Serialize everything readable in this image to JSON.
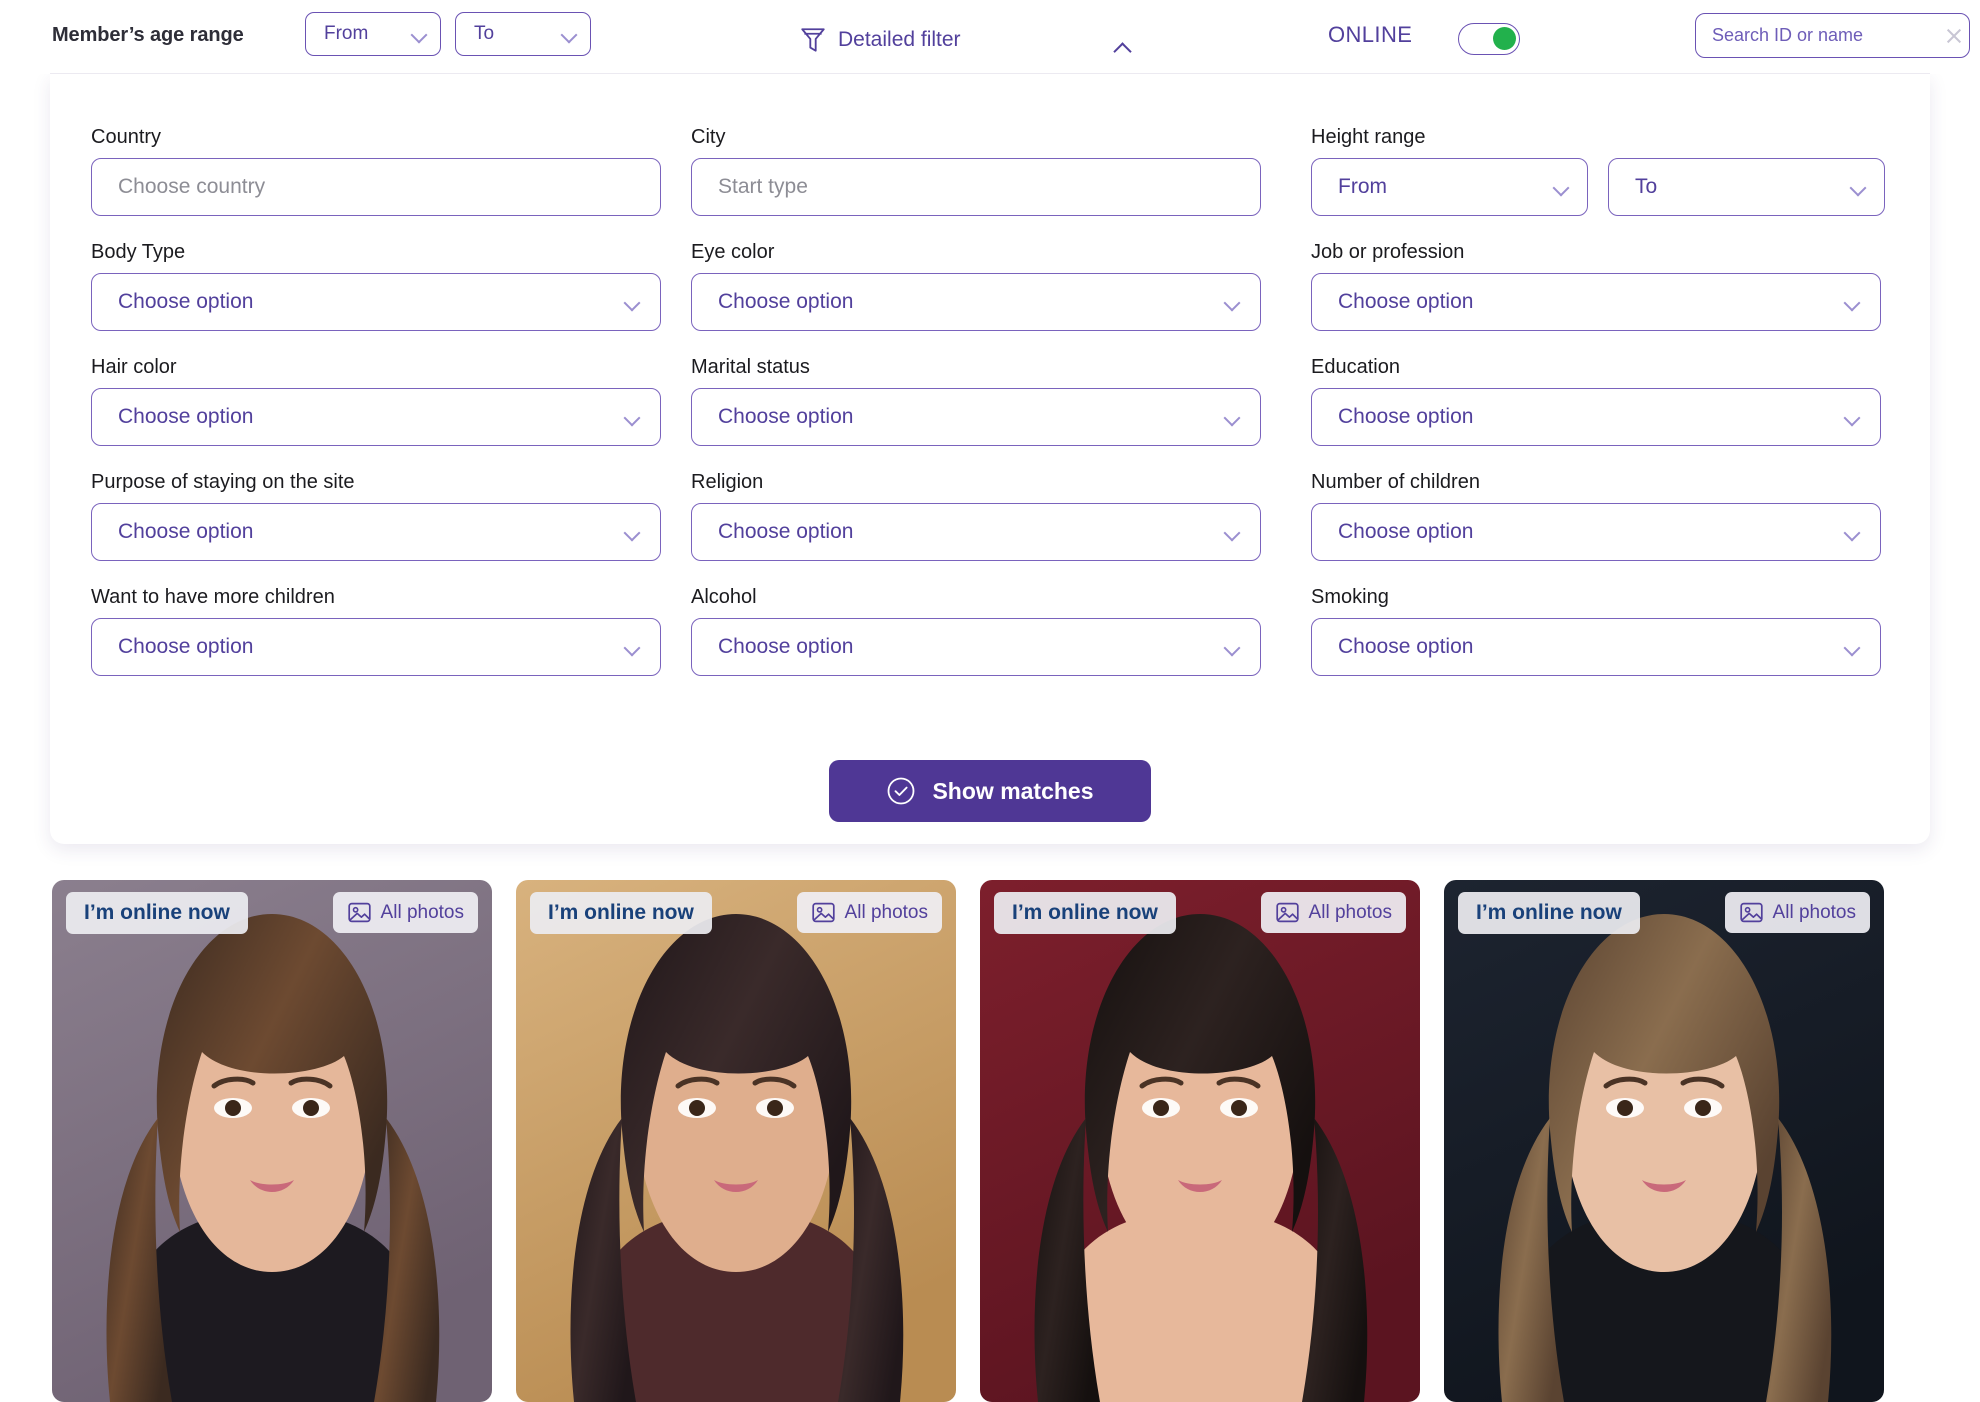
{
  "topbar": {
    "age_range_label": "Member’s age range",
    "age_from": "From",
    "age_to": "To",
    "detailed_filter_label": "Detailed filter",
    "filter_icon": "funnel-icon",
    "collapse_icon": "chevron-up-icon",
    "online_label": "ONLINE",
    "online_toggle_on": true,
    "online_toggle_color": "#22b14c",
    "search_placeholder": "Search ID or name",
    "search_value": "",
    "search_clear_icon": "close-icon"
  },
  "filter_panel": {
    "fields": [
      {
        "label": "Country",
        "type": "input",
        "value": "",
        "placeholder": "Choose country",
        "name": "country"
      },
      {
        "label": "City",
        "type": "input",
        "value": "",
        "placeholder": "Start type",
        "name": "city"
      },
      {
        "label": "Height range",
        "type": "range",
        "from": "From",
        "to": "To",
        "name": "height-range"
      },
      {
        "label": "Body Type",
        "type": "select",
        "value": "Choose option",
        "name": "body-type"
      },
      {
        "label": "Eye color",
        "type": "select",
        "value": "Choose option",
        "name": "eye-color"
      },
      {
        "label": "Job or profession",
        "type": "select",
        "value": "Choose option",
        "name": "job-or-profession"
      },
      {
        "label": "Hair color",
        "type": "select",
        "value": "Choose option",
        "name": "hair-color"
      },
      {
        "label": "Marital status",
        "type": "select",
        "value": "Choose option",
        "name": "marital-status"
      },
      {
        "label": "Education",
        "type": "select",
        "value": "Choose option",
        "name": "education"
      },
      {
        "label": "Purpose of staying on the site",
        "type": "select",
        "value": "Choose option",
        "name": "purpose-of-staying"
      },
      {
        "label": "Religion",
        "type": "select",
        "value": "Choose option",
        "name": "religion"
      },
      {
        "label": "Number of children",
        "type": "select",
        "value": "Choose option",
        "name": "number-of-children"
      },
      {
        "label": "Want to have more children",
        "type": "select",
        "value": "Choose option",
        "name": "want-more-children"
      },
      {
        "label": "Alcohol",
        "type": "select",
        "value": "Choose option",
        "name": "alcohol"
      },
      {
        "label": "Smoking",
        "type": "select",
        "value": "Choose option",
        "name": "smoking"
      }
    ],
    "show_matches_label": "Show matches",
    "show_matches_icon": "check-circle-icon",
    "accent_color": "#4f3795",
    "border_color": "#7a63bd"
  },
  "results": {
    "online_badge_label": "I’m online now",
    "all_photos_label": "All photos",
    "all_photos_icon": "image-icon",
    "cards": [
      {
        "name": "profile-card-1",
        "bg_a": "#8b7f8e",
        "bg_b": "#6f6273",
        "hair": "#3b2a20",
        "hair2": "#6d4a31",
        "skin": "#e5b79a",
        "top": "#1d1a20"
      },
      {
        "name": "profile-card-2",
        "bg_a": "#d8b27e",
        "bg_b": "#b98c52",
        "hair": "#20171a",
        "hair2": "#3a2a2a",
        "skin": "#dfae8d",
        "top": "#4e2a2c"
      },
      {
        "name": "profile-card-3",
        "bg_a": "#7d1f2c",
        "bg_b": "#5b1420",
        "hair": "#15100f",
        "hair2": "#2d2220",
        "skin": "#e7b89b",
        "top": "#e7b89b"
      },
      {
        "name": "profile-card-4",
        "bg_a": "#1d2430",
        "bg_b": "#10151d",
        "hair": "#5a4331",
        "hair2": "#8a6d4e",
        "skin": "#e8c0a5",
        "top": "#15171c"
      }
    ]
  }
}
